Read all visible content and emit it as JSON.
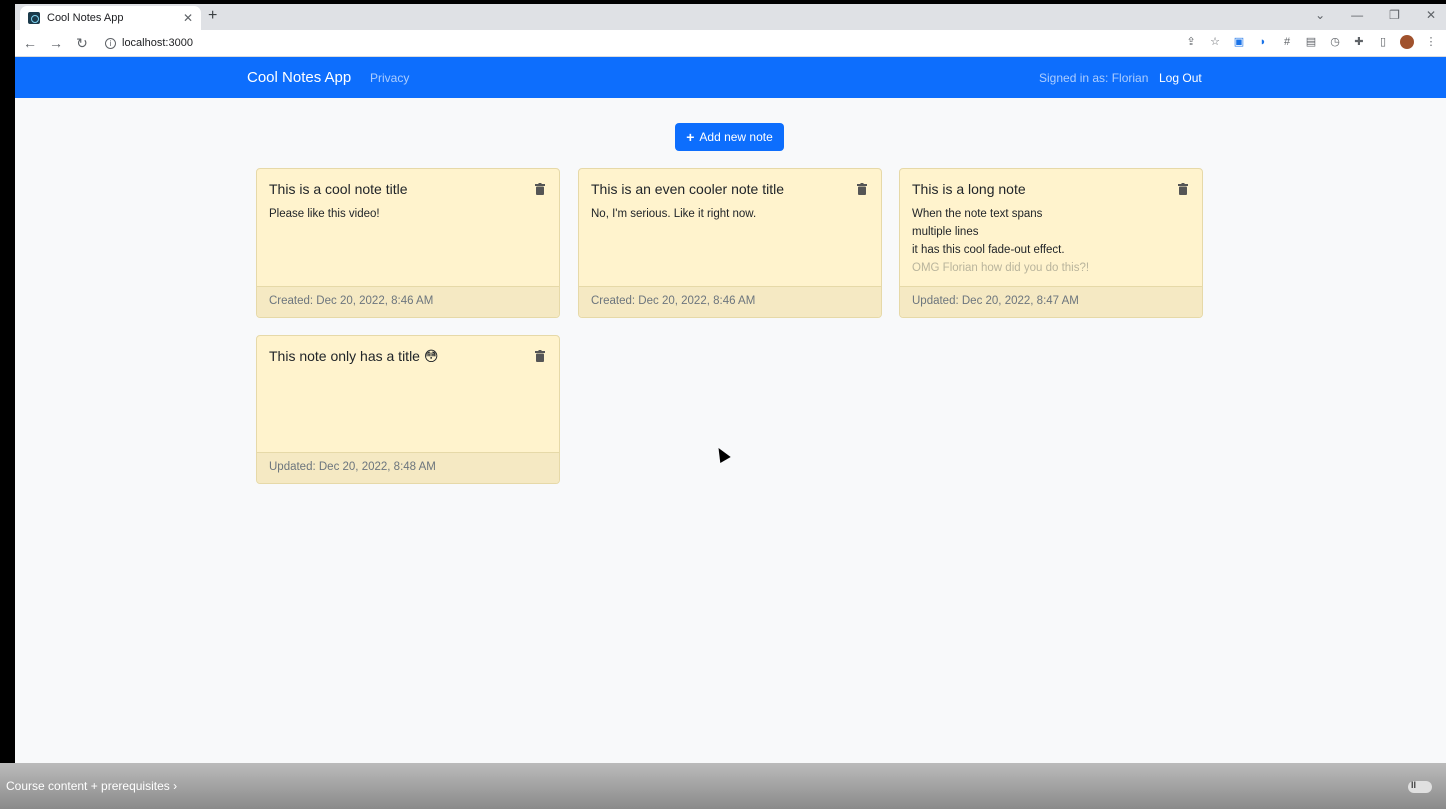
{
  "browser": {
    "tab_title": "Cool Notes App",
    "tab_close": "✕",
    "new_tab": "+",
    "address": "localhost:3000",
    "icons": [
      "back-icon",
      "forward-icon",
      "reload-icon",
      "info-icon",
      "share-icon",
      "star-icon",
      "extension-icons",
      "profile-avatar",
      "menu-icon"
    ]
  },
  "navbar": {
    "brand": "Cool Notes App",
    "privacy": "Privacy",
    "signed_in": "Signed in as: Florian",
    "logout": "Log Out",
    "color": "#0d6efd"
  },
  "actions": {
    "add_note": "Add new note"
  },
  "notes": [
    {
      "title": "This is a cool note title",
      "text": "Please like this video!",
      "footer": "Created: Dec 20, 2022, 8:46 AM"
    },
    {
      "title": "This is an even cooler note title",
      "text": "No, I'm serious. Like it right now.",
      "footer": "Created: Dec 20, 2022, 8:46 AM"
    },
    {
      "title": "This is a long note",
      "text": "When the note text spans\nmultiple lines\nit has this cool fade-out effect.",
      "text_faded": "OMG Florian how did you do this?!",
      "footer": "Updated: Dec 20, 2022, 8:47 AM"
    },
    {
      "title": "This note only has a title 😳",
      "text": "",
      "footer": "Updated: Dec 20, 2022, 8:48 AM"
    }
  ],
  "colors": {
    "card_bg": "#fff3cd",
    "card_footer_bg": "#f5e9c3",
    "page_bg": "#f8f9fa"
  },
  "video_overlay": {
    "course_link": "Course content + prerequisites"
  }
}
